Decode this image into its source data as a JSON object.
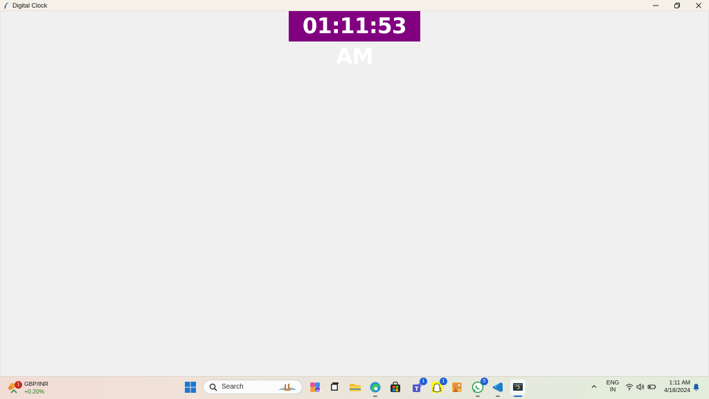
{
  "window": {
    "title": "Digital Clock",
    "minimize_icon": "minimize-icon",
    "restore_icon": "restore-icon",
    "close_icon": "close-icon"
  },
  "clock": {
    "time": "01:11:53 AM",
    "background": "#800080",
    "color": "#ffffff"
  },
  "taskbar": {
    "widget": {
      "badge": "1",
      "title": "GBP/INR",
      "change": "+0.20%"
    },
    "search": {
      "placeholder": "Search"
    },
    "apps": [
      {
        "name": "copilot"
      },
      {
        "name": "task-view"
      },
      {
        "name": "file-explorer"
      },
      {
        "name": "edge"
      },
      {
        "name": "microsoft-store"
      },
      {
        "name": "teams",
        "badge": "1"
      },
      {
        "name": "snapchat",
        "badge": "1"
      },
      {
        "name": "photos"
      },
      {
        "name": "whatsapp",
        "badge": "0"
      },
      {
        "name": "vs-code"
      },
      {
        "name": "python-idle"
      }
    ],
    "tray": {
      "language_line1": "ENG",
      "language_line2": "IN",
      "time": "1:11 AM",
      "date": "4/18/2024"
    }
  }
}
